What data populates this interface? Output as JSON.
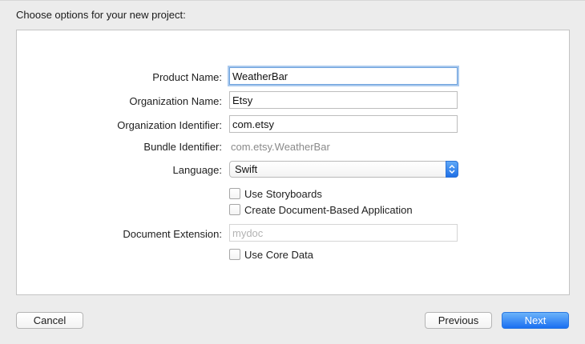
{
  "dialog": {
    "heading": "Choose options for your new project:"
  },
  "form": {
    "product_name": {
      "label": "Product Name:",
      "value": "WeatherBar"
    },
    "organization_name": {
      "label": "Organization Name:",
      "value": "Etsy"
    },
    "organization_identifier": {
      "label": "Organization Identifier:",
      "value": "com.etsy"
    },
    "bundle_identifier": {
      "label": "Bundle Identifier:",
      "value": "com.etsy.WeatherBar"
    },
    "language": {
      "label": "Language:",
      "value": "Swift"
    },
    "use_storyboards": {
      "label": "Use Storyboards",
      "checked": false
    },
    "document_based": {
      "label": "Create Document-Based Application",
      "checked": false
    },
    "document_extension": {
      "label": "Document Extension:",
      "placeholder": "mydoc",
      "enabled": false
    },
    "use_core_data": {
      "label": "Use Core Data",
      "checked": false
    }
  },
  "buttons": {
    "cancel": "Cancel",
    "previous": "Previous",
    "next": "Next"
  },
  "colors": {
    "accent": "#1a6ff1",
    "focus_ring": "#a9c9ee"
  }
}
